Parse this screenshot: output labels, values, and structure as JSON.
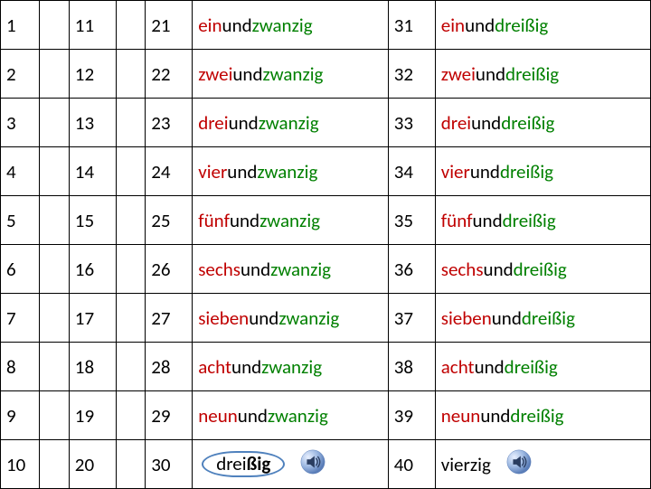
{
  "rows": [
    {
      "c0": "1",
      "c2": "11",
      "c4": "21",
      "c5": [
        {
          "t": "ein",
          "c": "red"
        },
        {
          "t": "und",
          "c": "black"
        },
        {
          "t": "zwanzig",
          "c": "green"
        }
      ],
      "c6": "31",
      "c7": [
        {
          "t": "ein",
          "c": "red"
        },
        {
          "t": "und",
          "c": "black"
        },
        {
          "t": "dreißig",
          "c": "green"
        }
      ]
    },
    {
      "c0": "2",
      "c2": "12",
      "c4": "22",
      "c5": [
        {
          "t": "zwei",
          "c": "red"
        },
        {
          "t": "und",
          "c": "black"
        },
        {
          "t": "zwanzig",
          "c": "green"
        }
      ],
      "c6": "32",
      "c7": [
        {
          "t": "zwei",
          "c": "red"
        },
        {
          "t": "und",
          "c": "black"
        },
        {
          "t": "dreißig",
          "c": "green"
        }
      ]
    },
    {
      "c0": "3",
      "c2": "13",
      "c4": "23",
      "c5": [
        {
          "t": "drei",
          "c": "red"
        },
        {
          "t": "und",
          "c": "black"
        },
        {
          "t": "zwanzig",
          "c": "green"
        }
      ],
      "c6": "33",
      "c7": [
        {
          "t": "drei",
          "c": "red"
        },
        {
          "t": "und",
          "c": "black"
        },
        {
          "t": "dreißig",
          "c": "green"
        }
      ]
    },
    {
      "c0": "4",
      "c2": "14",
      "c4": "24",
      "c5": [
        {
          "t": "vier",
          "c": "red"
        },
        {
          "t": "und",
          "c": "black"
        },
        {
          "t": "zwanzig",
          "c": "green"
        }
      ],
      "c6": "34",
      "c7": [
        {
          "t": "vier",
          "c": "red"
        },
        {
          "t": "und",
          "c": "black"
        },
        {
          "t": "dreißig",
          "c": "green"
        }
      ]
    },
    {
      "c0": "5",
      "c2": "15",
      "c4": "25",
      "c5": [
        {
          "t": "fünf",
          "c": "red"
        },
        {
          "t": "und",
          "c": "black"
        },
        {
          "t": "zwanzig",
          "c": "green"
        }
      ],
      "c6": "35",
      "c7": [
        {
          "t": "fünf",
          "c": "red"
        },
        {
          "t": "und",
          "c": "black"
        },
        {
          "t": "dreißig",
          "c": "green"
        }
      ]
    },
    {
      "c0": "6",
      "c2": "16",
      "c4": "26",
      "c5": [
        {
          "t": "sechs",
          "c": "red"
        },
        {
          "t": "und",
          "c": "black"
        },
        {
          "t": "zwanzig",
          "c": "green"
        }
      ],
      "c6": "36",
      "c7": [
        {
          "t": "sechs",
          "c": "red"
        },
        {
          "t": "und",
          "c": "black"
        },
        {
          "t": "dreißig",
          "c": "green"
        }
      ]
    },
    {
      "c0": "7",
      "c2": "17",
      "c4": "27",
      "c5": [
        {
          "t": "sieben",
          "c": "red"
        },
        {
          "t": "und",
          "c": "black"
        },
        {
          "t": "zwanzig",
          "c": "green"
        }
      ],
      "c6": "37",
      "c7": [
        {
          "t": "sieben",
          "c": "red"
        },
        {
          "t": "und",
          "c": "black"
        },
        {
          "t": "dreißig",
          "c": "green"
        }
      ]
    },
    {
      "c0": "8",
      "c2": "18",
      "c4": "28",
      "c5": [
        {
          "t": "acht",
          "c": "red"
        },
        {
          "t": "und",
          "c": "black"
        },
        {
          "t": "zwanzig",
          "c": "green"
        }
      ],
      "c6": "38",
      "c7": [
        {
          "t": "acht",
          "c": "red"
        },
        {
          "t": "und",
          "c": "black"
        },
        {
          "t": "dreißig",
          "c": "green"
        }
      ]
    },
    {
      "c0": "9",
      "c2": "19",
      "c4": "29",
      "c5": [
        {
          "t": "neun",
          "c": "red"
        },
        {
          "t": "und",
          "c": "black"
        },
        {
          "t": "zwanzig",
          "c": "green"
        }
      ],
      "c6": "39",
      "c7": [
        {
          "t": "neun",
          "c": "red"
        },
        {
          "t": "und",
          "c": "black"
        },
        {
          "t": "dreißig",
          "c": "green"
        }
      ]
    },
    {
      "c0": "10",
      "c2": "20",
      "c4": "30",
      "c5_special": {
        "pre": "drei",
        "suf": "ßig"
      },
      "c6": "40",
      "c7_plain": "vierzig",
      "speaker5": true,
      "speaker7": true
    }
  ],
  "colors": {
    "red": "#c00000",
    "green": "#008000",
    "black": "#000000"
  }
}
